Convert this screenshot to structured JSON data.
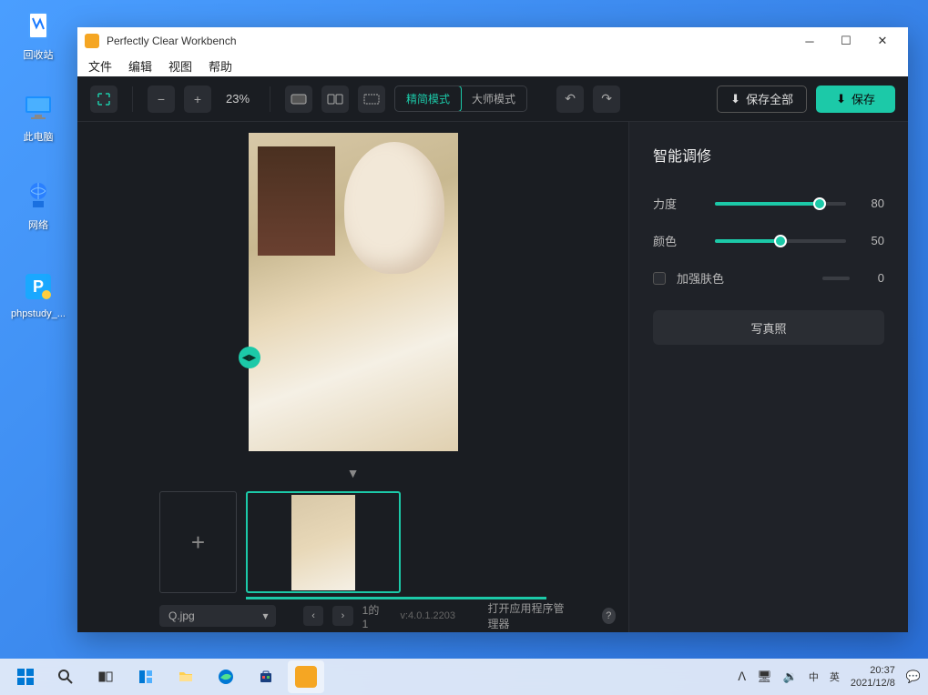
{
  "desktop": {
    "recycle": "回收站",
    "pc": "此电脑",
    "network": "网络",
    "phpstudy": "phpstudy_..."
  },
  "titlebar": {
    "title": "Perfectly Clear Workbench"
  },
  "menu": {
    "file": "文件",
    "edit": "编辑",
    "view": "视图",
    "help": "帮助"
  },
  "toolbar": {
    "zoom": "23%",
    "mode_simple": "精简模式",
    "mode_master": "大师模式",
    "save_all": "保存全部",
    "save": "保存"
  },
  "panel": {
    "title": "智能调修",
    "strength_label": "力度",
    "strength_value": "80",
    "strength_pct": 80,
    "color_label": "颜色",
    "color_value": "50",
    "color_pct": 50,
    "skin_label": "加强肤色",
    "skin_value": "0",
    "preset": "写真照"
  },
  "bottom": {
    "filename": "Q.jpg",
    "page": "1的1",
    "version": "v:4.0.1.2203",
    "app_mgr": "打开应用程序管理器"
  },
  "taskbar": {
    "ime_lang": "英",
    "ime_ctry": "中",
    "time": "20:37",
    "date": "2021/12/8"
  }
}
